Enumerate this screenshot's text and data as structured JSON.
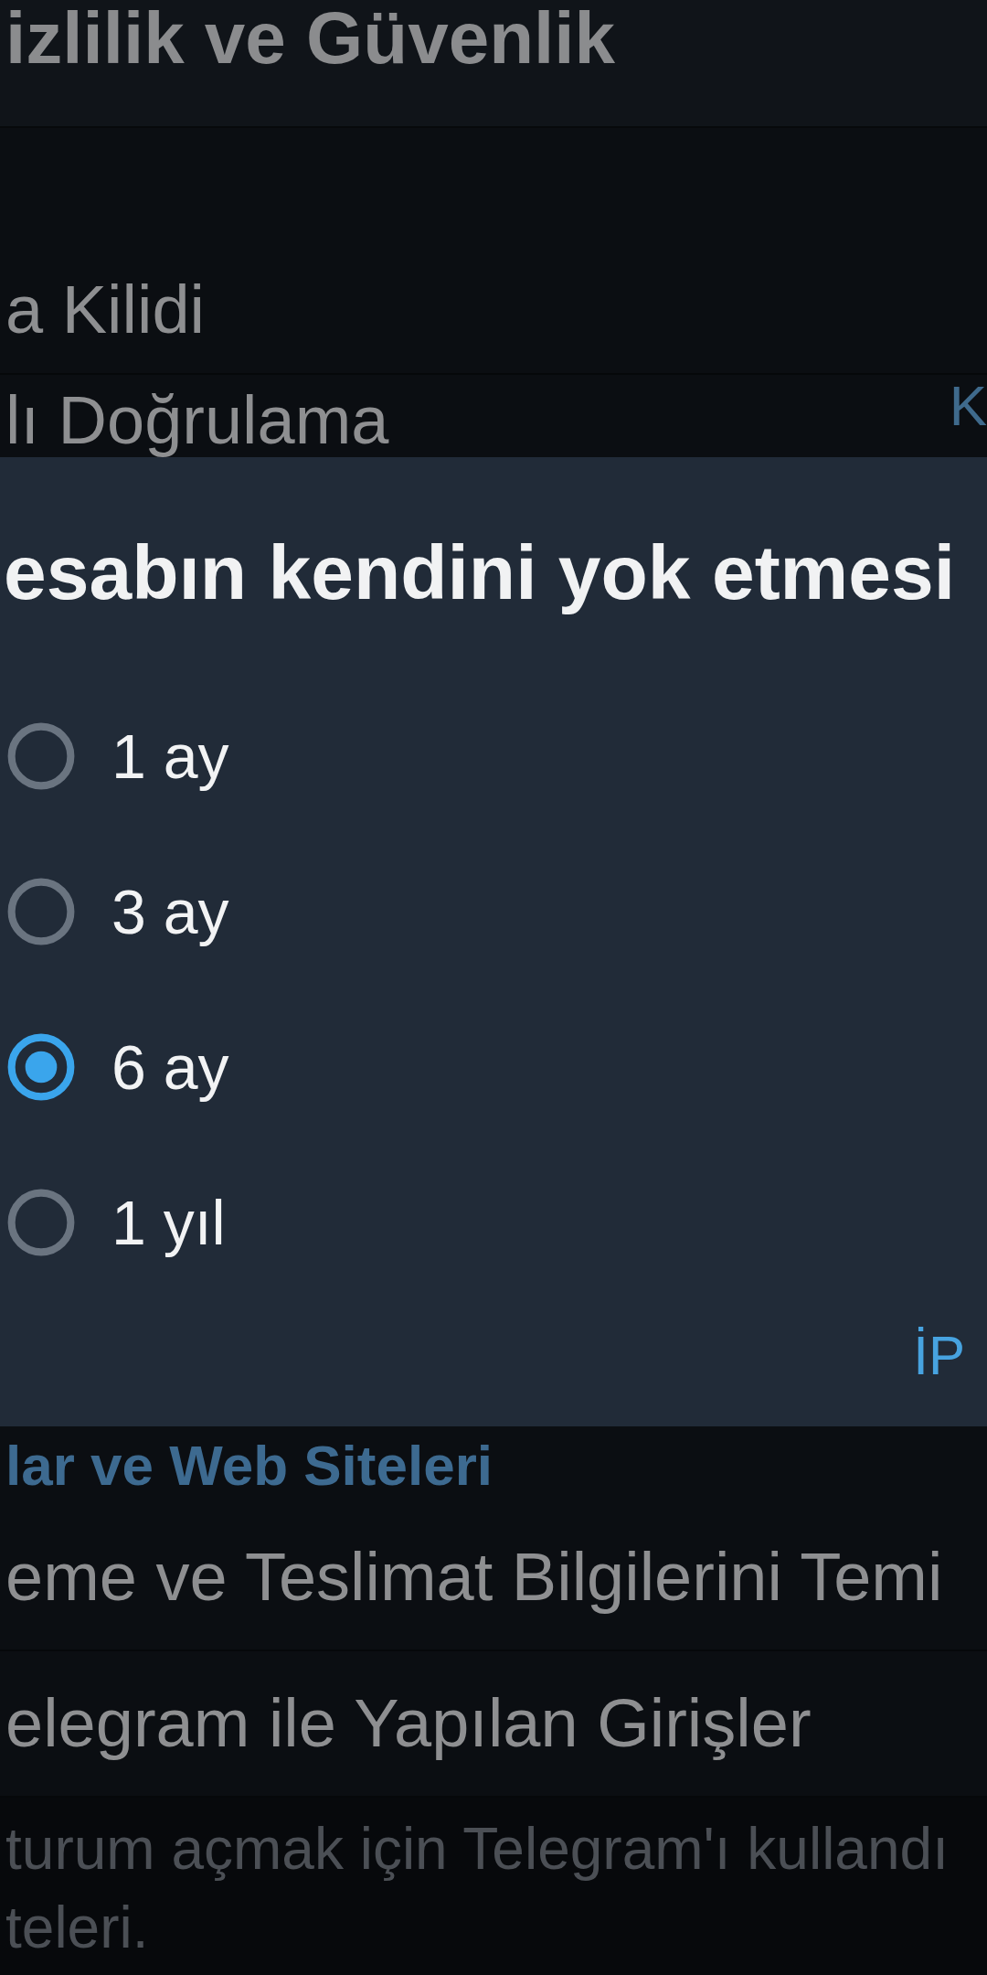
{
  "header": {
    "title": "izlilik ve Güvenlik"
  },
  "rows_top": [
    {
      "label": "a Kilidi"
    },
    {
      "label": "lı Doğrulama",
      "value": "K"
    }
  ],
  "dialog": {
    "title": "esabın kendini yok etmesi",
    "options": [
      {
        "label": "1 ay",
        "selected": false
      },
      {
        "label": "3 ay",
        "selected": false
      },
      {
        "label": "6 ay",
        "selected": true
      },
      {
        "label": "1 yıl",
        "selected": false
      }
    ],
    "buttons": [
      "İP"
    ]
  },
  "section": {
    "header": "lar ve Web Siteleri",
    "rows": [
      {
        "label": "eme ve Teslimat Bilgilerini Temi"
      },
      {
        "label": "elegram ile Yapılan Girişler"
      }
    ],
    "footer_lines": [
      "turum açmak için Telegram'ı kullandı",
      "teleri."
    ]
  }
}
